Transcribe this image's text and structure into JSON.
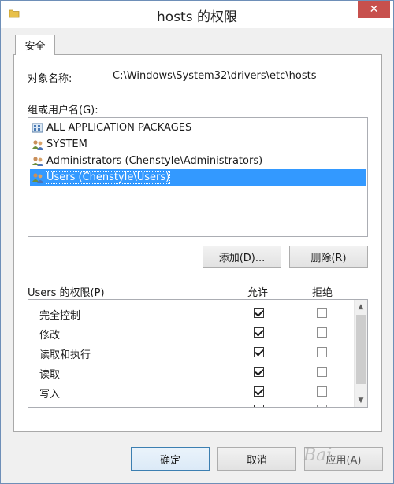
{
  "window": {
    "title": "hosts 的权限",
    "close_glyph": "✕"
  },
  "tabs": [
    {
      "label": "安全",
      "active": true
    }
  ],
  "object": {
    "label": "对象名称:",
    "value": "C:\\Windows\\System32\\drivers\\etc\\hosts"
  },
  "groups": {
    "label": "组或用户名(G):",
    "items": [
      {
        "label": "ALL APPLICATION PACKAGES",
        "icon": "app-packages-icon",
        "selected": false
      },
      {
        "label": "SYSTEM",
        "icon": "users-group-icon",
        "selected": false
      },
      {
        "label": "Administrators (Chenstyle\\Administrators)",
        "icon": "users-group-icon",
        "selected": false
      },
      {
        "label": "Users (Chenstyle\\Users)",
        "icon": "users-group-icon",
        "selected": true
      }
    ]
  },
  "buttons": {
    "add": "添加(D)...",
    "remove": "删除(R)",
    "ok": "确定",
    "cancel": "取消",
    "apply": "应用(A)"
  },
  "permissions": {
    "title": "Users 的权限(P)",
    "allow_header": "允许",
    "deny_header": "拒绝",
    "rows": [
      {
        "name": "完全控制",
        "allow": true,
        "deny": false
      },
      {
        "name": "修改",
        "allow": true,
        "deny": false
      },
      {
        "name": "读取和执行",
        "allow": true,
        "deny": false
      },
      {
        "name": "读取",
        "allow": true,
        "deny": false
      },
      {
        "name": "写入",
        "allow": true,
        "deny": false
      }
    ]
  },
  "watermark": "Bai"
}
